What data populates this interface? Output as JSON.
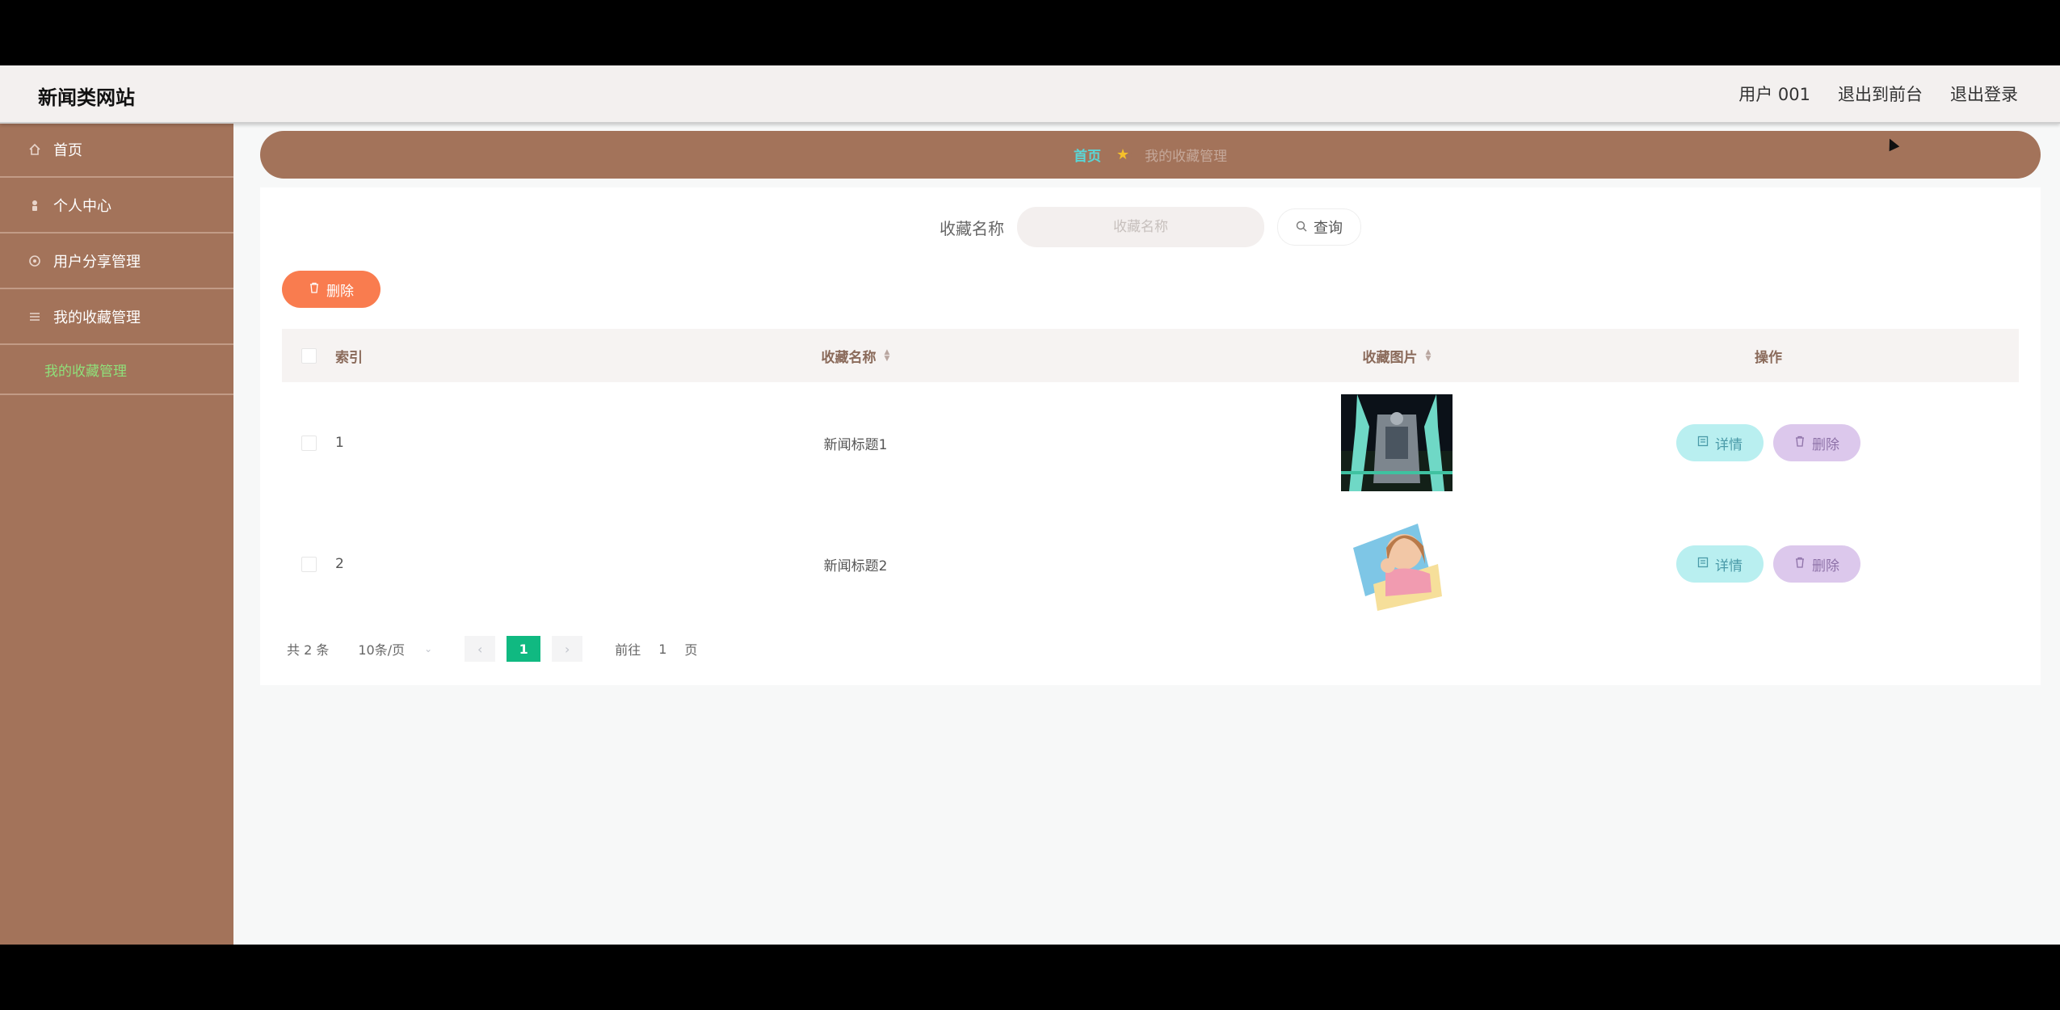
{
  "app": {
    "title": "新闻类网站"
  },
  "topbar": {
    "user": "用户 001",
    "to_front": "退出到前台",
    "logout": "退出登录"
  },
  "sidebar": {
    "items": [
      {
        "label": "首页",
        "icon": "home-icon"
      },
      {
        "label": "个人中心",
        "icon": "person-icon"
      },
      {
        "label": "用户分享管理",
        "icon": "share-icon"
      },
      {
        "label": "我的收藏管理",
        "icon": "menu-icon"
      }
    ],
    "sub_item": "我的收藏管理"
  },
  "breadcrumb": {
    "home": "首页",
    "current": "我的收藏管理"
  },
  "search": {
    "label": "收藏名称",
    "placeholder": "收藏名称",
    "button": "查询"
  },
  "batch_delete": "删除",
  "table": {
    "headers": {
      "index": "索引",
      "name": "收藏名称",
      "image": "收藏图片",
      "ops": "操作"
    },
    "rows": [
      {
        "index": "1",
        "name": "新闻标题1",
        "detail": "详情",
        "delete": "删除"
      },
      {
        "index": "2",
        "name": "新闻标题2",
        "detail": "详情",
        "delete": "删除"
      }
    ]
  },
  "pagination": {
    "total": "共 2 条",
    "page_size": "10条/页",
    "current_page": "1",
    "goto_prefix": "前往",
    "goto_value": "1",
    "goto_suffix": "页"
  },
  "colors": {
    "brand_brown": "#a3735a",
    "accent_green": "#10b981",
    "delete_orange": "#f97c4f",
    "detail_cyan": "#b9eff0",
    "delete_purple": "#dcc8ec"
  }
}
